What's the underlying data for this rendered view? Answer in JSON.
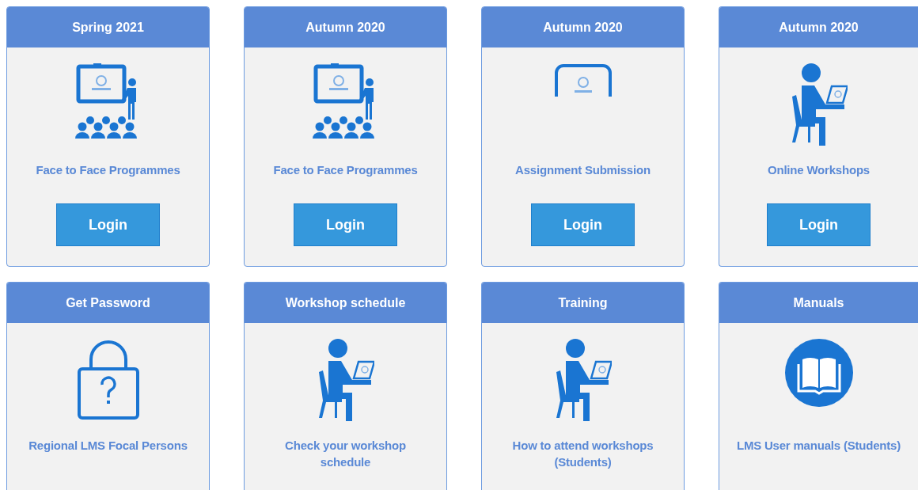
{
  "cards": [
    {
      "title": "Spring 2021",
      "kind": "classroom",
      "description": "Face to Face Programmes",
      "button": "Login"
    },
    {
      "title": "Autumn 2020",
      "kind": "classroom",
      "description": "Face to Face Programmes",
      "button": "Login"
    },
    {
      "title": "Autumn 2020",
      "kind": "board-partial",
      "description": "Assignment Submission",
      "button": "Login"
    },
    {
      "title": "Autumn 2020",
      "kind": "laptop-user",
      "description": "Online Workshops",
      "button": "Login"
    },
    {
      "title": "Get Password",
      "kind": "padlock",
      "description": "Regional LMS Focal Persons"
    },
    {
      "title": "Workshop schedule",
      "kind": "laptop-user",
      "description": "Check your workshop schedule"
    },
    {
      "title": "Training",
      "kind": "laptop-user",
      "description": "How to attend workshops (Students)"
    },
    {
      "title": "Manuals",
      "kind": "book",
      "description": "LMS User manuals (Students)"
    }
  ]
}
